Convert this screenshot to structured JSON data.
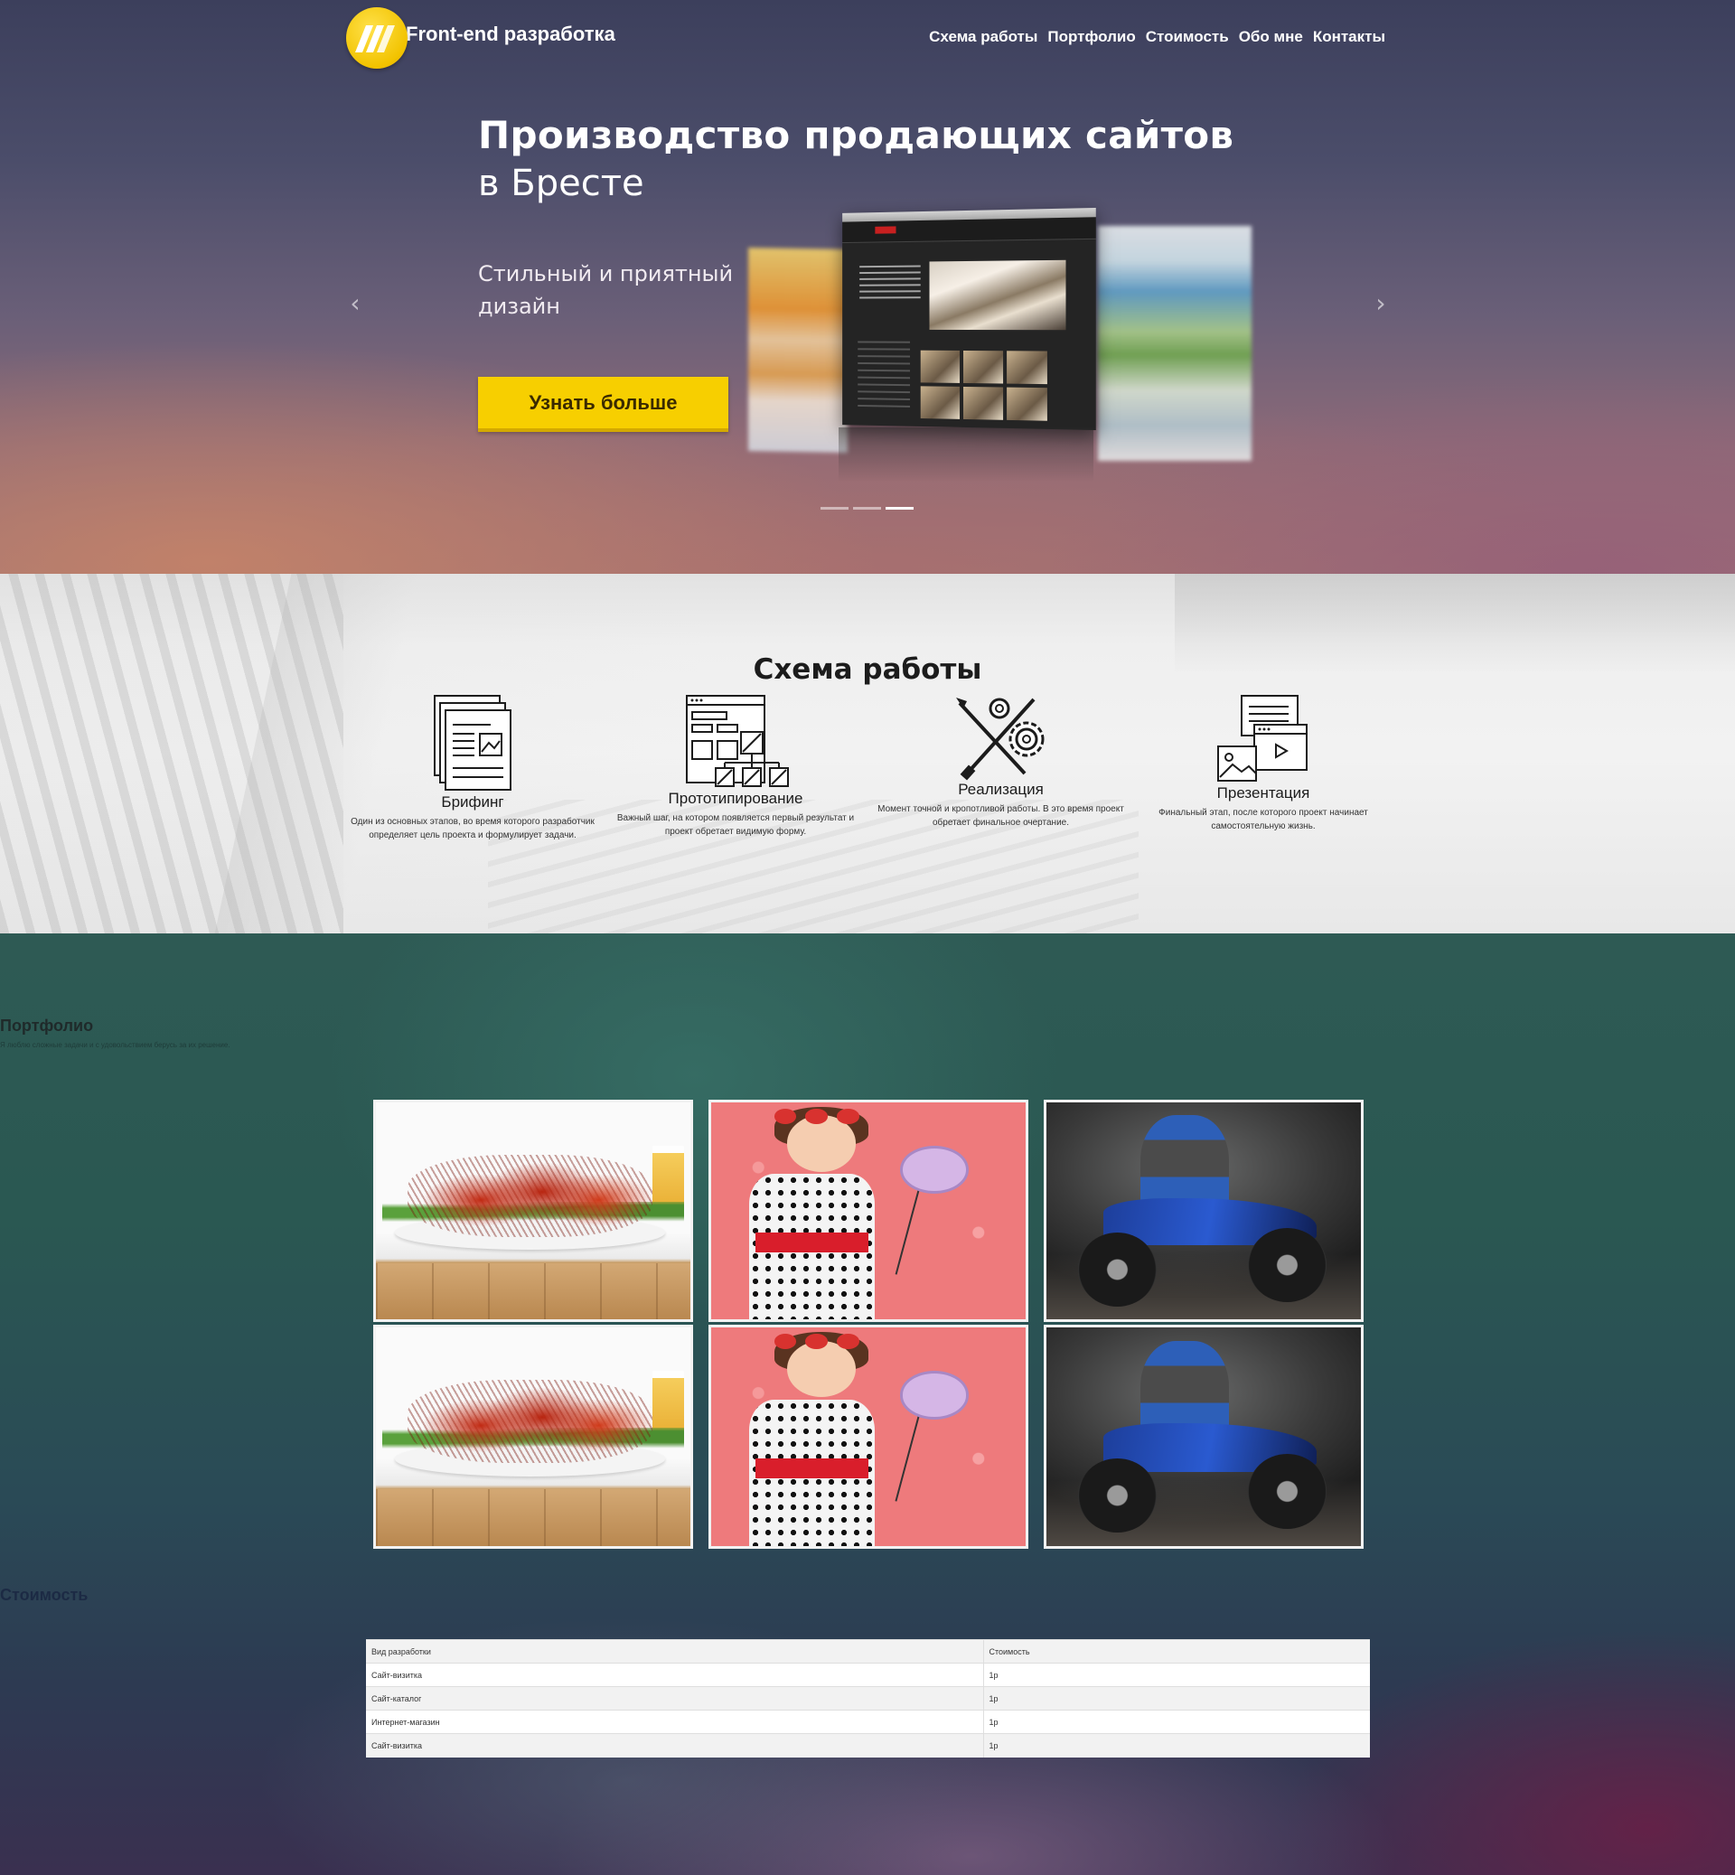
{
  "brand": {
    "name": "Front-end разработка",
    "accent_color": "#f7cf00"
  },
  "nav": {
    "items": [
      {
        "label": "Схема работы"
      },
      {
        "label": "Портфолио"
      },
      {
        "label": "Стоимость"
      },
      {
        "label": "Обо мне"
      },
      {
        "label": "Контакты"
      }
    ]
  },
  "hero": {
    "title": "Производство продающих сайтов",
    "subtitle": "в Бресте",
    "description": "Стильный и приятный дизайн",
    "button_label": "Узнать больше",
    "prev_arrow": "‹",
    "next_arrow": "›",
    "slides_count": 3,
    "active_slide": 3
  },
  "scheme": {
    "title": "Схема работы",
    "steps": [
      {
        "icon": "documents-icon",
        "label": "Брифинг",
        "text": "Один из основных этапов, во время которого разработчик определяет цель проекта и формулирует задачи."
      },
      {
        "icon": "prototype-icon",
        "label": "Прототипирование",
        "text": "Важный шаг, на котором появляется первый результат и проект обретает видимую форму."
      },
      {
        "icon": "tools-icon",
        "label": "Реализация",
        "text": "Момент точной и кропотливой работы. В это время проект обретает финальное очертание."
      },
      {
        "icon": "presentation-icon",
        "label": "Презентация",
        "text": "Финальный этап, после которого проект начинает самостоятельную жизнь."
      }
    ]
  },
  "portfolio": {
    "title": "Портфолио",
    "subtitle": "Я люблю сложные задачи и с удовольствием берусь за их решение."
  },
  "pricing": {
    "title": "Стоимость",
    "header": {
      "type": "Вид разработки",
      "price": "Стоимость"
    },
    "rows": [
      {
        "type": "Сайт-визитка",
        "price": "1р"
      },
      {
        "type": "Сайт-каталог",
        "price": "1р"
      },
      {
        "type": "Интернет-магазин",
        "price": "1р"
      },
      {
        "type": "Сайт-визитка",
        "price": "1р"
      }
    ]
  }
}
